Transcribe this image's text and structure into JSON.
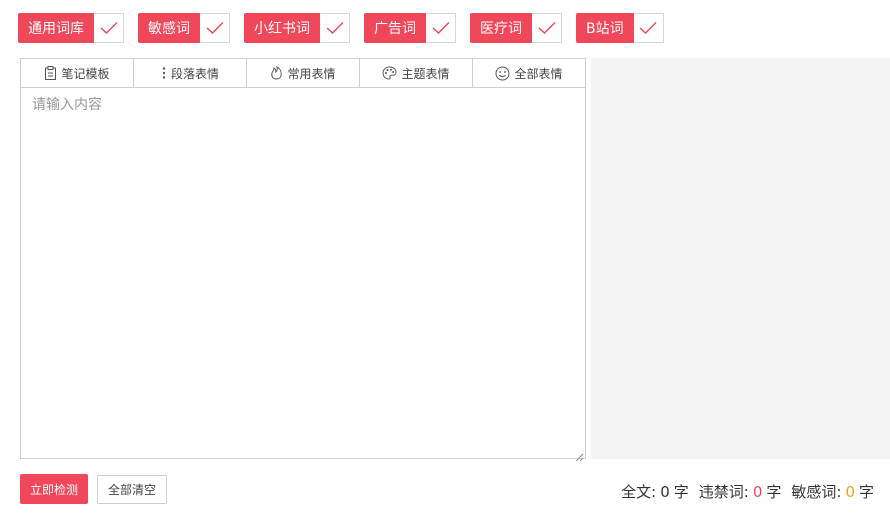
{
  "tags": [
    {
      "label": "通用词库",
      "checked": true
    },
    {
      "label": "敏感词",
      "checked": true
    },
    {
      "label": "小红书词",
      "checked": true
    },
    {
      "label": "广告词",
      "checked": true
    },
    {
      "label": "医疗词",
      "checked": true
    },
    {
      "label": "B站词",
      "checked": true
    }
  ],
  "toolbar": {
    "note_template": "笔记模板",
    "paragraph_emoji": "段落表情",
    "common_emoji": "常用表情",
    "theme_emoji": "主题表情",
    "all_emoji": "全部表情"
  },
  "editor": {
    "placeholder": "请输入内容",
    "value": ""
  },
  "actions": {
    "detect": "立即检测",
    "clear_all": "全部清空"
  },
  "stats": {
    "total_label": "全文:",
    "total_count": "0",
    "banned_label": "违禁词:",
    "banned_count": "0",
    "sensitive_label": "敏感词:",
    "sensitive_count": "0",
    "unit": "字"
  },
  "colors": {
    "accent": "#f0475a",
    "banned_count": "#f0475a",
    "sensitive_count": "#f0a020",
    "preview_bg": "#f4f4f4"
  }
}
